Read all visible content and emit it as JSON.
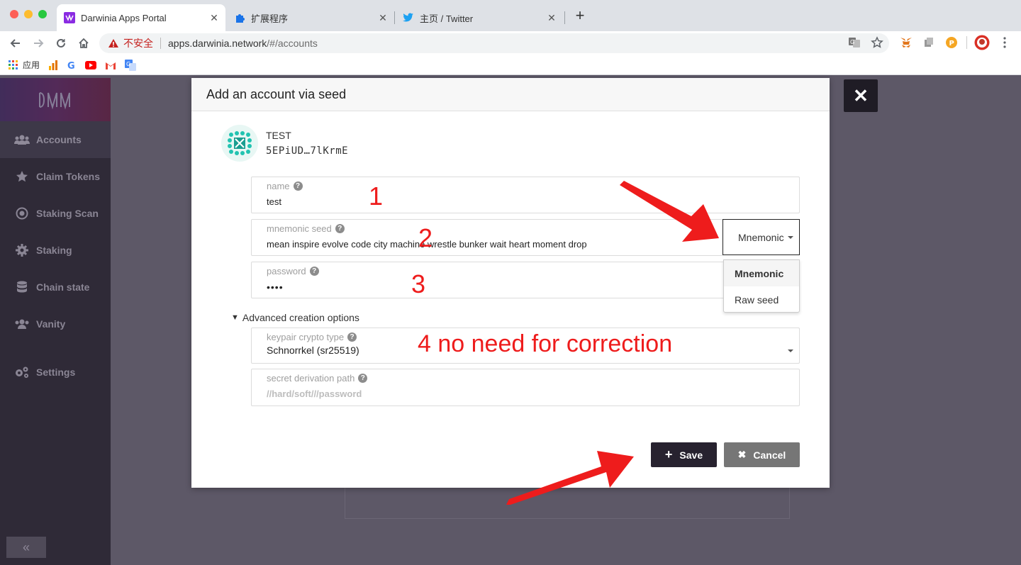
{
  "browser": {
    "tabs": [
      {
        "title": "Darwinia Apps Portal",
        "favicon": "darwinia-icon",
        "active": true
      },
      {
        "title": "扩展程序",
        "favicon": "puzzle-icon",
        "active": false
      },
      {
        "title": "主页 / Twitter",
        "favicon": "twitter-icon",
        "active": false
      }
    ],
    "security_label": "不安全",
    "url_host": "apps.darwinia.network",
    "url_path": "/#/accounts",
    "bookmarks": [
      {
        "label": "应用",
        "icon": "apps-grid-icon"
      },
      {
        "label": "",
        "icon": "analytics-icon"
      },
      {
        "label": "",
        "icon": "google-icon"
      },
      {
        "label": "",
        "icon": "youtube-icon"
      },
      {
        "label": "",
        "icon": "gmail-icon"
      },
      {
        "label": "",
        "icon": "translate-icon"
      }
    ]
  },
  "sidebar": {
    "items": [
      {
        "label": "Accounts",
        "icon": "users-icon",
        "active": true
      },
      {
        "label": "Claim Tokens",
        "icon": "star-icon",
        "active": false
      },
      {
        "label": "Staking Scan",
        "icon": "target-icon",
        "active": false
      },
      {
        "label": "Staking",
        "icon": "cog-icon",
        "active": false
      },
      {
        "label": "Chain state",
        "icon": "database-icon",
        "active": false
      },
      {
        "label": "Vanity",
        "icon": "users-icon",
        "active": false
      },
      {
        "label": "Settings",
        "icon": "cogs-icon",
        "active": false
      }
    ],
    "collapse_label": "«"
  },
  "modal": {
    "title": "Add an account via seed",
    "account": {
      "name": "TEST",
      "address": "5EPiUD…7lKrmE"
    },
    "fields": {
      "name": {
        "label": "name",
        "value": "test"
      },
      "seed": {
        "label": "mnemonic seed",
        "value": "mean inspire evolve code city machine wrestle bunker wait heart moment drop"
      },
      "password": {
        "label": "password",
        "value": "••••"
      },
      "crypto": {
        "label": "keypair crypto type",
        "value": "Schnorrkel (sr25519)"
      },
      "derivation": {
        "label": "secret derivation path",
        "placeholder": "//hard/soft///password"
      }
    },
    "seed_type": {
      "selected": "Mnemonic",
      "options": [
        "Mnemonic",
        "Raw seed"
      ]
    },
    "advanced_label": "Advanced creation options",
    "save_label": "Save",
    "cancel_label": "Cancel"
  },
  "annotations": {
    "a1": "1",
    "a2": "2",
    "a3": "3",
    "a4": "4 no need for correction",
    "color": "#ee1c1c"
  },
  "close_label": "✕"
}
